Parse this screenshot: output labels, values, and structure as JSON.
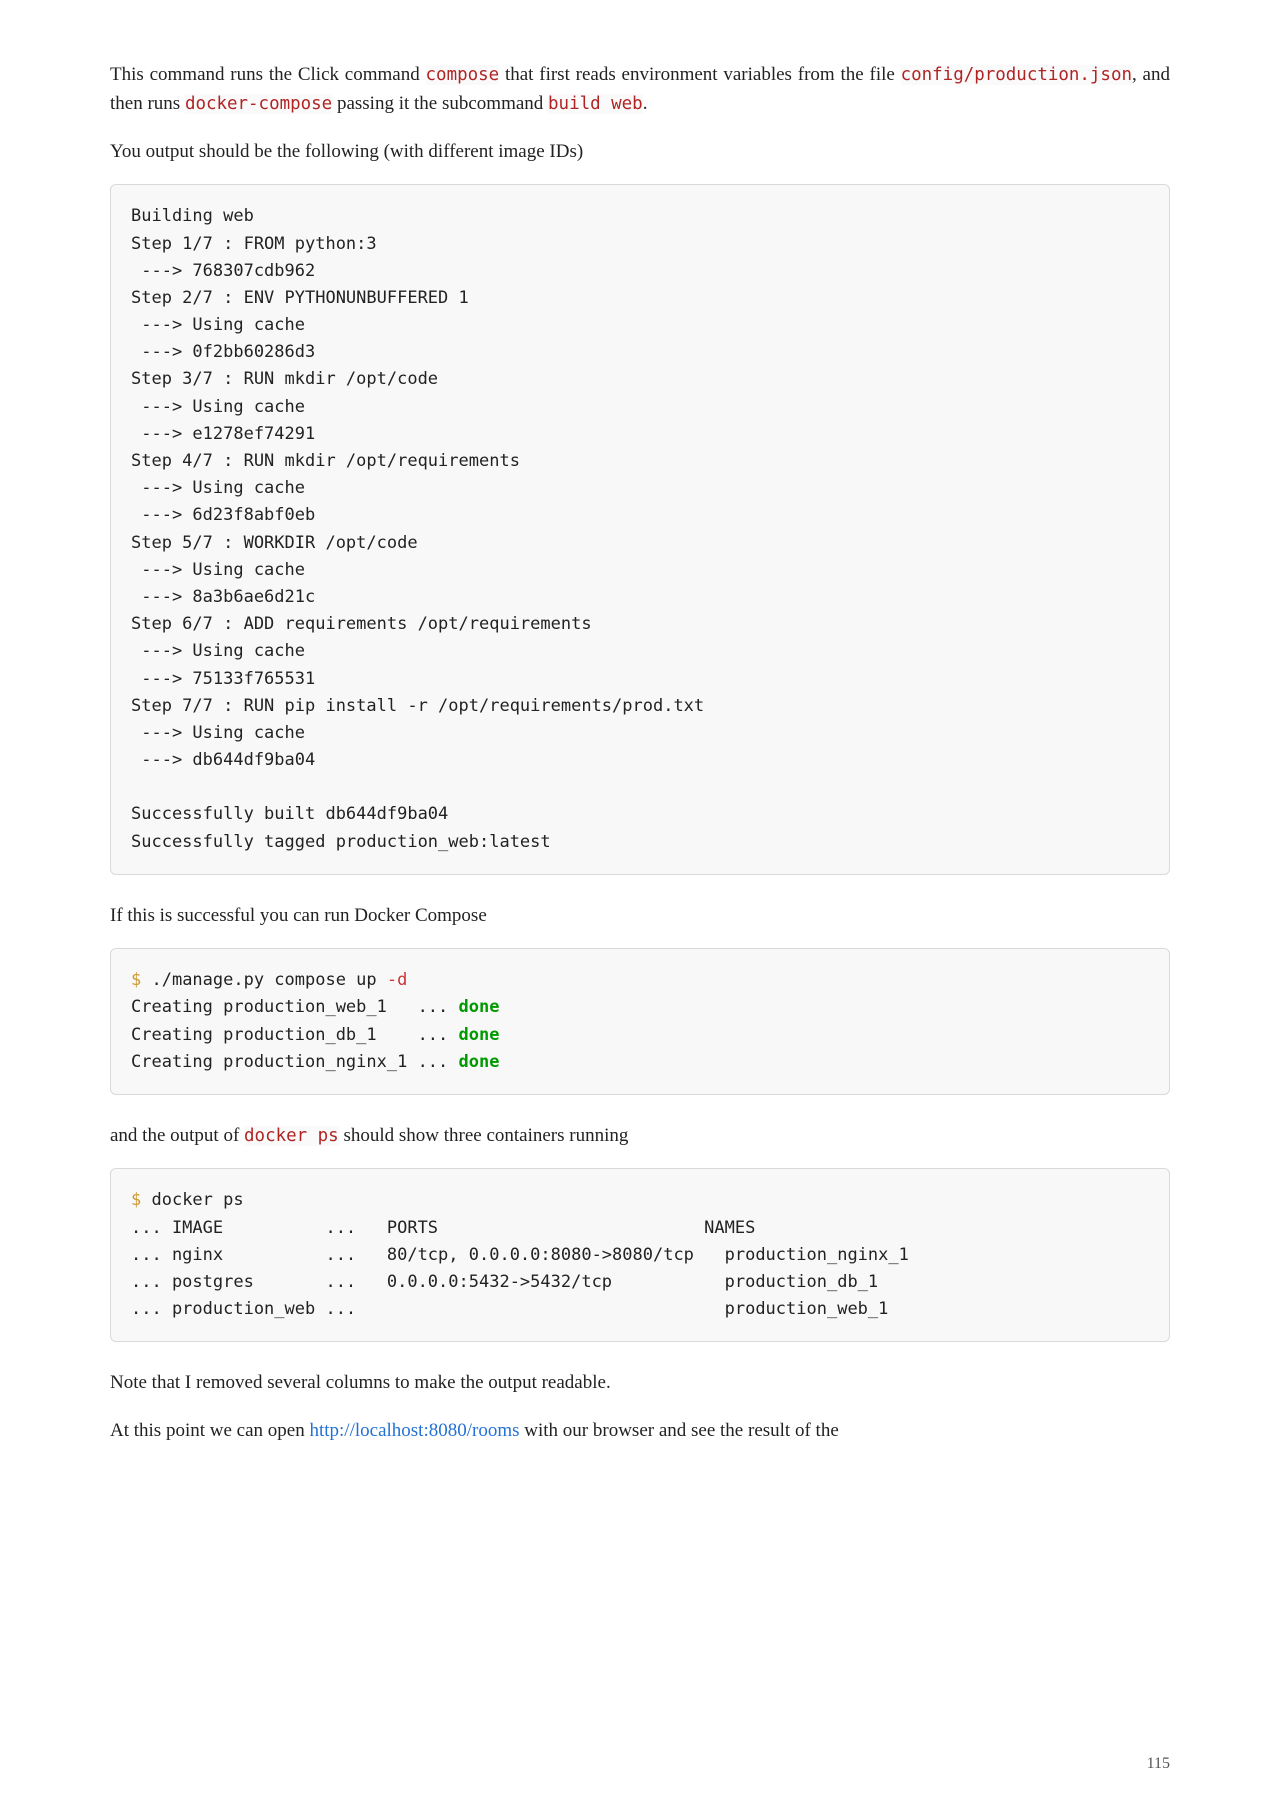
{
  "para1": {
    "t1": "This command runs the Click command ",
    "c1": "compose",
    "t2": " that first reads environment variables from the file ",
    "c2": "config/production.json",
    "t3": ", and then runs ",
    "c3": "docker-compose",
    "t4": " passing it the subcommand ",
    "c4": "build web",
    "t5": "."
  },
  "para2": "You output should be the following (with different image IDs)",
  "code1": "Building web\nStep 1/7 : FROM python:3\n ---> 768307cdb962\nStep 2/7 : ENV PYTHONUNBUFFERED 1\n ---> Using cache\n ---> 0f2bb60286d3\nStep 3/7 : RUN mkdir /opt/code\n ---> Using cache\n ---> e1278ef74291\nStep 4/7 : RUN mkdir /opt/requirements\n ---> Using cache\n ---> 6d23f8abf0eb\nStep 5/7 : WORKDIR /opt/code\n ---> Using cache\n ---> 8a3b6ae6d21c\nStep 6/7 : ADD requirements /opt/requirements\n ---> Using cache\n ---> 75133f765531\nStep 7/7 : RUN pip install -r /opt/requirements/prod.txt\n ---> Using cache\n ---> db644df9ba04\n\nSuccessfully built db644df9ba04\nSuccessfully tagged production_web:latest",
  "para3": "If this is successful you can run Docker Compose",
  "code2": {
    "dollar": "$",
    "cmd": " ./manage.py compose up ",
    "flag": "-d",
    "l1a": "Creating production_web_1   ... ",
    "l2a": "Creating production_db_1    ... ",
    "l3a": "Creating production_nginx_1 ... ",
    "done": "done"
  },
  "para4": {
    "t1": "and the output of ",
    "c1": "docker ps",
    "t2": " should show three containers running"
  },
  "code3": {
    "dollar": "$",
    "cmd": " docker ps",
    "rest": "... IMAGE          ...   PORTS                          NAMES\n... nginx          ...   80/tcp, 0.0.0.0:8080->8080/tcp   production_nginx_1\n... postgres       ...   0.0.0.0:5432->5432/tcp           production_db_1\n... production_web ...                                    production_web_1"
  },
  "para5": "Note that I removed several columns to make the output readable.",
  "para6": {
    "t1": "At this point we can open ",
    "link_text": "http://localhost:8080/rooms",
    "link_href": "http://localhost:8080/rooms",
    "t2": " with our browser and see the result of the"
  },
  "page_number": "115"
}
